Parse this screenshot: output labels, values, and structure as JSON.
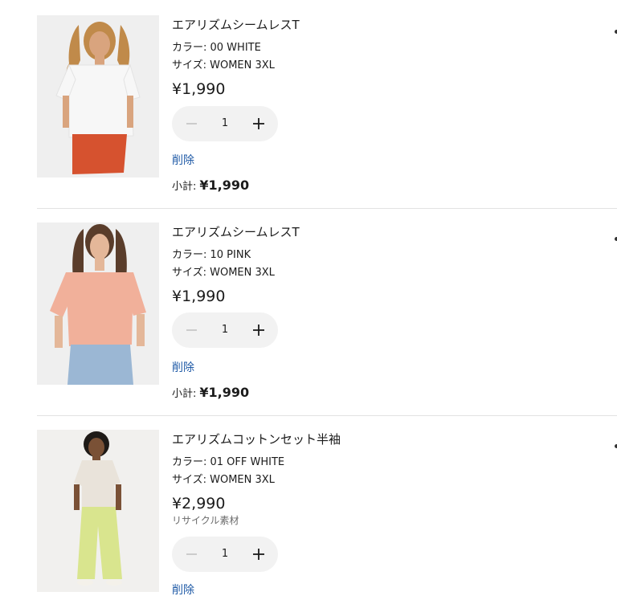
{
  "cart": {
    "remove_label": "削除",
    "subtotal_label": "小計:",
    "items": [
      {
        "name": "エアリズムシームレスT",
        "color": "カラー: 00 WHITE",
        "size": "サイズ: WOMEN 3XL",
        "price": "¥1,990",
        "quantity": "1",
        "subtotal": "¥1,990",
        "image_colors": {
          "background": "#efefef",
          "top": "#f7f7f7",
          "bottom": "#d6522f",
          "hair": "#c08a4a",
          "skin": "#d9a47e"
        }
      },
      {
        "name": "エアリズムシームレスT",
        "color": "カラー: 10 PINK",
        "size": "サイズ: WOMEN 3XL",
        "price": "¥1,990",
        "quantity": "1",
        "subtotal": "¥1,990",
        "image_colors": {
          "background": "#efefef",
          "top": "#f1b09a",
          "bottom": "#9bb7d4",
          "hair": "#5a3d2b",
          "skin": "#e4b799"
        }
      },
      {
        "name": "エアリズムコットンセット半袖",
        "color": "カラー: 01 OFF WHITE",
        "size": "サイズ: WOMEN 3XL",
        "price": "¥2,990",
        "note": "リサイクル素材",
        "quantity": "1",
        "image_colors": {
          "background": "#f1f0ee",
          "top": "#e9e3da",
          "bottom": "#d9e58e",
          "hair": "#1e1a17",
          "skin": "#7a5136"
        }
      }
    ]
  },
  "colors": {
    "link": "#1f5aa6",
    "stepper_bg": "#f2f2f2",
    "divider": "#e2e2e2"
  }
}
